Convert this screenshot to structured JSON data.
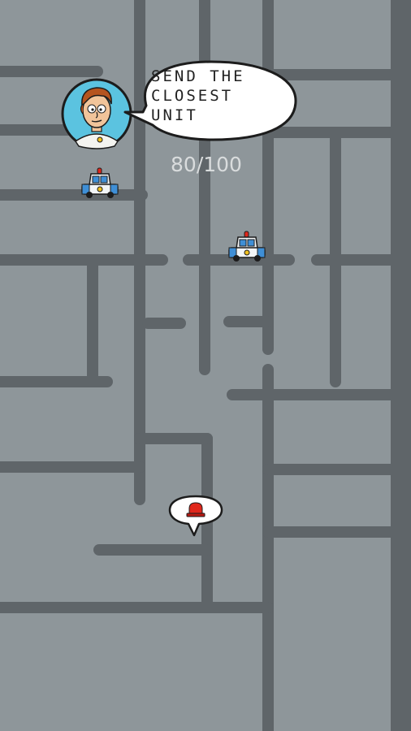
{
  "dispatcher": {
    "speech": "SEND THE\nCLOSEST\nUNIT"
  },
  "score": {
    "text": "80/100",
    "current": 80,
    "max": 100
  },
  "units": [
    {
      "id": "car-1",
      "icon": "police-car-icon"
    },
    {
      "id": "car-2",
      "icon": "police-car-icon"
    }
  ],
  "incident": {
    "icon": "siren-icon",
    "color": "#e0271c"
  },
  "colors": {
    "ground": "#8e969a",
    "road": "#5f6569",
    "score_text": "#d9dcdd",
    "car_body": "#f2f5f7",
    "car_accent": "#3f8fd6"
  }
}
